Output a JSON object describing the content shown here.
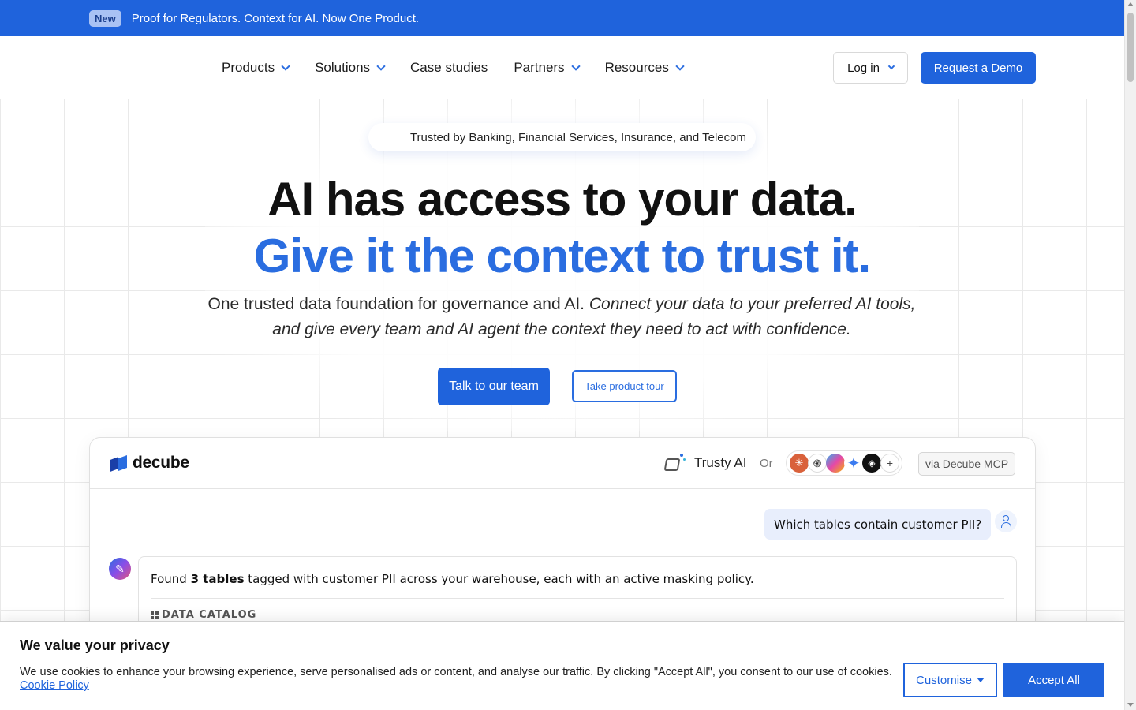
{
  "announcement": {
    "badge": "New",
    "message": "Proof for Regulators. Context for AI. Now One Product."
  },
  "nav": {
    "items": [
      {
        "label": "Products",
        "has_dropdown": true
      },
      {
        "label": "Solutions",
        "has_dropdown": true
      },
      {
        "label": "Case studies",
        "has_dropdown": false
      },
      {
        "label": "Partners",
        "has_dropdown": true
      },
      {
        "label": "Resources",
        "has_dropdown": true
      }
    ],
    "login_label": "Log in",
    "demo_label": "Request a Demo"
  },
  "hero": {
    "trusted_pill": "Trusted by Banking, Financial Services, Insurance, and Telecom",
    "headline_1": "AI has access to your data.",
    "headline_2": "Give it the context to trust it.",
    "subtitle_plain": "One trusted data foundation for governance and AI. ",
    "subtitle_italic": "Connect your data to your preferred AI tools, and give every team and AI agent the context they need to act with confidence.",
    "cta_primary": "Talk to our team",
    "cta_secondary": "Take product tour"
  },
  "demo_card": {
    "logo_text": "decube",
    "assistant_name": "Trusty AI",
    "or_label": "Or",
    "tool_icons": [
      "claude-icon",
      "chatgpt-icon",
      "copilot-icon",
      "gemini-icon",
      "cube-icon",
      "plus-icon"
    ],
    "plus_label": "+",
    "via_label": "via Decube MCP",
    "question": "Which tables contain customer PII?",
    "answer_pre": "Found ",
    "answer_bold": "3 tables",
    "answer_post": " tagged with customer PII across your warehouse, each with an active masking policy.",
    "section_label": "DATA CATALOG"
  },
  "cookie": {
    "title": "We value your privacy",
    "body": "We use cookies to enhance your browsing experience, serve personalised ads or content, and analyse our traffic. By clicking \"Accept All\", you consent to our use of cookies. ",
    "policy_link": "Cookie Policy",
    "customise_label": "Customise",
    "accept_label": "Accept All"
  },
  "colors": {
    "brand_blue": "#1f63dc",
    "headline_blue": "#2a6de0"
  }
}
